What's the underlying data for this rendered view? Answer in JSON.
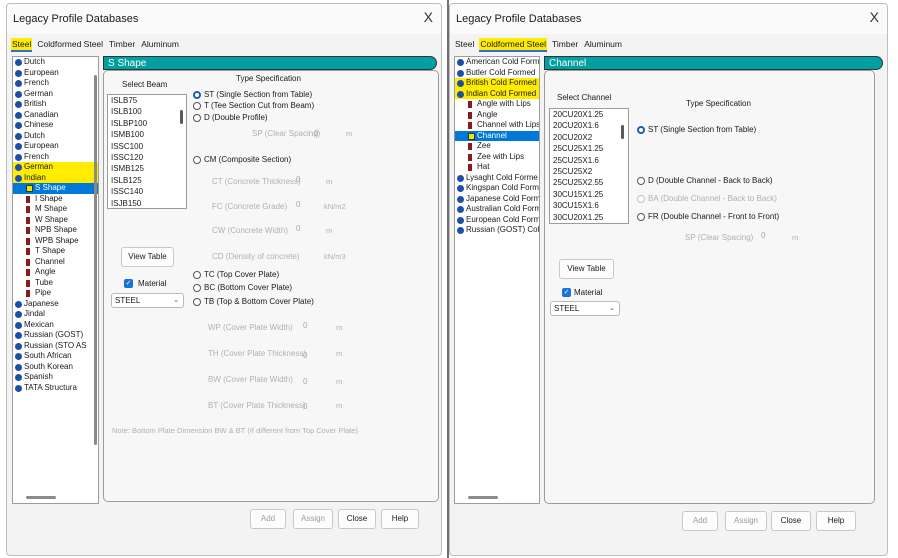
{
  "left": {
    "title": "Legacy Profile Databases",
    "close": "X",
    "tabs": [
      "Steel",
      "Coldformed Steel",
      "Timber",
      "Aluminum"
    ],
    "tree": [
      {
        "label": "Dutch"
      },
      {
        "label": "European"
      },
      {
        "label": "French"
      },
      {
        "label": "German"
      },
      {
        "label": "British"
      },
      {
        "label": "Canadian"
      },
      {
        "label": "Chinese"
      },
      {
        "label": "Dutch"
      },
      {
        "label": "European"
      },
      {
        "label": "French"
      },
      {
        "label": "German"
      },
      {
        "label": "Indian"
      },
      {
        "label": "S Shape"
      },
      {
        "label": "I Shape"
      },
      {
        "label": "M Shape"
      },
      {
        "label": "W Shape"
      },
      {
        "label": "NPB Shape"
      },
      {
        "label": "WPB Shape"
      },
      {
        "label": "T Shape"
      },
      {
        "label": "Channel"
      },
      {
        "label": "Angle"
      },
      {
        "label": "Tube"
      },
      {
        "label": "Pipe"
      },
      {
        "label": "Japanese"
      },
      {
        "label": "Jindal"
      },
      {
        "label": "Mexican"
      },
      {
        "label": "Russian (GOST)"
      },
      {
        "label": "Russian (STO AS"
      },
      {
        "label": "South African"
      },
      {
        "label": "South Korean"
      },
      {
        "label": "Spanish"
      },
      {
        "label": "TATA Structura"
      }
    ],
    "header": "S Shape",
    "select_label": "Select Beam",
    "beams": [
      "ISLB75",
      "ISLB100",
      "ISLBP100",
      "ISMB100",
      "ISSC100",
      "ISSC120",
      "ISMB125",
      "ISLB125",
      "ISSC140",
      "ISJB150"
    ],
    "view_table": "View Table",
    "material_label": "Material",
    "material_value": "STEEL",
    "type_spec": "Type Specification",
    "radios": {
      "st": "ST (Single Section from Table)",
      "t": "T (Tee Section Cut from Beam)",
      "d": "D (Double Profile)",
      "cm": "CM (Composite Section)",
      "tc": "TC (Top Cover Plate)",
      "bc": "BC (Bottom Cover Plate)",
      "tb": "TB (Top & Bottom Cover Plate)"
    },
    "fields": {
      "sp": {
        "label": "SP (Clear Spacing)",
        "value": "0",
        "unit": "m"
      },
      "ct": {
        "label": "CT (Concrete Thickness)",
        "value": "0",
        "unit": "m"
      },
      "fc": {
        "label": "FC (Concrete Grade)",
        "value": "0",
        "unit": "kN/m2"
      },
      "cw": {
        "label": "CW (Concrete Width)",
        "value": "0",
        "unit": "m"
      },
      "cd": {
        "label": "CD (Density of concrete)",
        "unit": "kN/m3"
      },
      "wp": {
        "label": "WP (Cover Plate Width)",
        "value": "0",
        "unit": "m"
      },
      "th": {
        "label": "TH (Cover Plate Thickness)",
        "value": "0",
        "unit": "m"
      },
      "bw": {
        "label": "BW (Cover Plate Width)",
        "value": "0",
        "unit": "m"
      },
      "bt": {
        "label": "BT (Cover Plate Thickness)",
        "value": "0",
        "unit": "m"
      }
    },
    "note": "Note: Bottom Plate Dimension BW & BT (If different from Top Cover Plate)",
    "buttons": {
      "add": "Add",
      "assign": "Assign",
      "close": "Close",
      "help": "Help"
    }
  },
  "right": {
    "title": "Legacy Profile Databases",
    "close": "X",
    "tabs": [
      "Steel",
      "Coldformed Steel",
      "Timber",
      "Aluminum"
    ],
    "tree": [
      {
        "label": "American Cold Form"
      },
      {
        "label": "Butler Cold Formed"
      },
      {
        "label": "British Cold Formed"
      },
      {
        "label": "Indian Cold Formed"
      },
      {
        "label": "Angle with Lips"
      },
      {
        "label": "Angle"
      },
      {
        "label": "Channel with Lips"
      },
      {
        "label": "Channel"
      },
      {
        "label": "Zee"
      },
      {
        "label": "Zee with Lips"
      },
      {
        "label": "Hat"
      },
      {
        "label": "Lysaght Cold Forme"
      },
      {
        "label": "Kingspan Cold Form"
      },
      {
        "label": "Japanese Cold Form"
      },
      {
        "label": "Australian Cold Form"
      },
      {
        "label": "European Cold Form"
      },
      {
        "label": "Russian (GOST) Col"
      }
    ],
    "header": "Channel",
    "select_label": "Select Channel",
    "channels": [
      "20CU20X1.25",
      "20CU20X1.6",
      "20CU20X2",
      "25CU25X1.25",
      "25CU25X1.6",
      "25CU25X2",
      "25CU25X2.55",
      "30CU15X1.25",
      "30CU15X1.6",
      "30CU20X1.25"
    ],
    "view_table": "View Table",
    "material_label": "Material",
    "material_value": "STEEL",
    "type_spec": "Type Specification",
    "radios": {
      "st": "ST (Single Section from Table)",
      "d": "D (Double Channel - Back to Back)",
      "ba": "BA (Double Channel - Back to Back)",
      "fr": "FR (Double Channel - Front to Front)"
    },
    "fields": {
      "sp": {
        "label": "SP (Clear Spacing)",
        "value": "0",
        "unit": "m"
      }
    },
    "buttons": {
      "add": "Add",
      "assign": "Assign",
      "close": "Close",
      "help": "Help"
    }
  },
  "colors": {
    "highlight": "#ffec00",
    "header_teal": "#00a0a0",
    "selection": "#0078d7",
    "accent": "#1a73d9"
  }
}
